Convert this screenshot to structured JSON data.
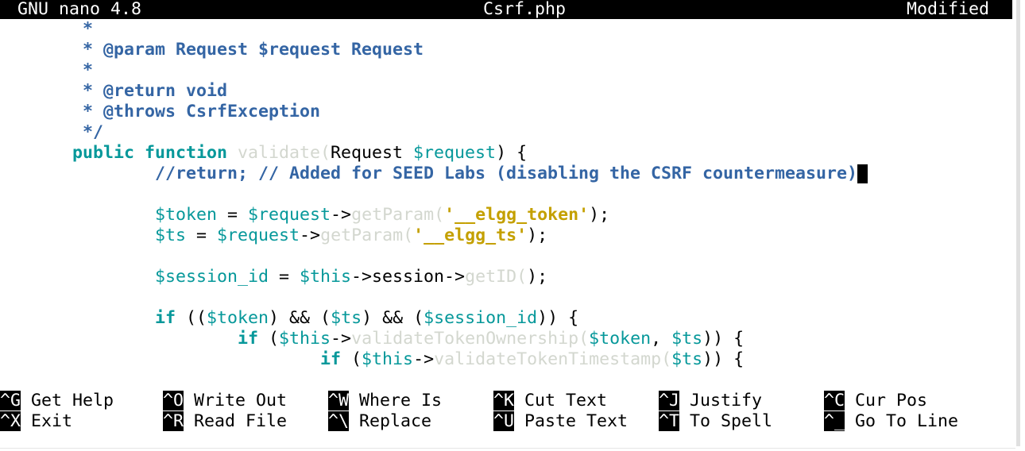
{
  "titlebar": {
    "app": "GNU nano 4.8",
    "file": "Csrf.php",
    "status": "Modified"
  },
  "editor": {
    "lines": [
      [
        {
          "t": "        *",
          "k": "comment"
        }
      ],
      [
        {
          "t": "        * @param Request $request Request",
          "k": "comment"
        }
      ],
      [
        {
          "t": "        *",
          "k": "comment"
        }
      ],
      [
        {
          "t": "        * @return void",
          "k": "comment"
        }
      ],
      [
        {
          "t": "        * @throws CsrfException",
          "k": "comment"
        }
      ],
      [
        {
          "t": "        */",
          "k": "comment"
        }
      ],
      [
        {
          "t": "       public function ",
          "k": "keyword"
        },
        {
          "t": "validate(",
          "k": "func"
        },
        {
          "t": "Request ",
          "k": "plain"
        },
        {
          "t": "$request",
          "k": "var"
        },
        {
          "t": ") {",
          "k": "plain"
        }
      ],
      [
        {
          "t": "               //return; // Added for SEED Labs (disabling the CSRF countermeasure)",
          "k": "comment"
        },
        {
          "t": "",
          "k": "cursor"
        }
      ],
      [],
      [
        {
          "t": "               $token",
          "k": "var"
        },
        {
          "t": " = ",
          "k": "plain"
        },
        {
          "t": "$request",
          "k": "var"
        },
        {
          "t": "->",
          "k": "plain"
        },
        {
          "t": "getParam(",
          "k": "func"
        },
        {
          "t": "'__elgg_token'",
          "k": "string"
        },
        {
          "t": ");",
          "k": "plain"
        }
      ],
      [
        {
          "t": "               $ts",
          "k": "var"
        },
        {
          "t": " = ",
          "k": "plain"
        },
        {
          "t": "$request",
          "k": "var"
        },
        {
          "t": "->",
          "k": "plain"
        },
        {
          "t": "getParam(",
          "k": "func"
        },
        {
          "t": "'__elgg_ts'",
          "k": "string"
        },
        {
          "t": ");",
          "k": "plain"
        }
      ],
      [],
      [
        {
          "t": "               $session_id",
          "k": "var"
        },
        {
          "t": " = ",
          "k": "plain"
        },
        {
          "t": "$this",
          "k": "var"
        },
        {
          "t": "->session->",
          "k": "plain"
        },
        {
          "t": "getID(",
          "k": "func"
        },
        {
          "t": ");",
          "k": "plain"
        }
      ],
      [],
      [
        {
          "t": "               if ",
          "k": "keyword"
        },
        {
          "t": "((",
          "k": "plain"
        },
        {
          "t": "$token",
          "k": "var"
        },
        {
          "t": ") && (",
          "k": "plain"
        },
        {
          "t": "$ts",
          "k": "var"
        },
        {
          "t": ") && (",
          "k": "plain"
        },
        {
          "t": "$session_id",
          "k": "var"
        },
        {
          "t": ")) {",
          "k": "plain"
        }
      ],
      [
        {
          "t": "                       if ",
          "k": "keyword"
        },
        {
          "t": "(",
          "k": "plain"
        },
        {
          "t": "$this",
          "k": "var"
        },
        {
          "t": "->",
          "k": "plain"
        },
        {
          "t": "validateTokenOwnership(",
          "k": "func"
        },
        {
          "t": "$token",
          "k": "var"
        },
        {
          "t": ", ",
          "k": "plain"
        },
        {
          "t": "$ts",
          "k": "var"
        },
        {
          "t": ")) {",
          "k": "plain"
        }
      ],
      [
        {
          "t": "                               if ",
          "k": "keyword"
        },
        {
          "t": "(",
          "k": "plain"
        },
        {
          "t": "$this",
          "k": "var"
        },
        {
          "t": "->",
          "k": "plain"
        },
        {
          "t": "validateTokenTimestamp(",
          "k": "func"
        },
        {
          "t": "$ts",
          "k": "var"
        },
        {
          "t": ")) {",
          "k": "plain"
        }
      ]
    ]
  },
  "shortcuts": {
    "row1": [
      {
        "key": "^G",
        "label": "Get Help"
      },
      {
        "key": "^O",
        "label": "Write Out"
      },
      {
        "key": "^W",
        "label": "Where Is"
      },
      {
        "key": "^K",
        "label": "Cut Text"
      },
      {
        "key": "^J",
        "label": "Justify"
      },
      {
        "key": "^C",
        "label": "Cur Pos"
      }
    ],
    "row2": [
      {
        "key": "^X",
        "label": "Exit"
      },
      {
        "key": "^R",
        "label": "Read File"
      },
      {
        "key": "^\\",
        "label": "Replace"
      },
      {
        "key": "^U",
        "label": "Paste Text"
      },
      {
        "key": "^T",
        "label": "To Spell"
      },
      {
        "key": "^_",
        "label": "Go To Line"
      }
    ]
  }
}
